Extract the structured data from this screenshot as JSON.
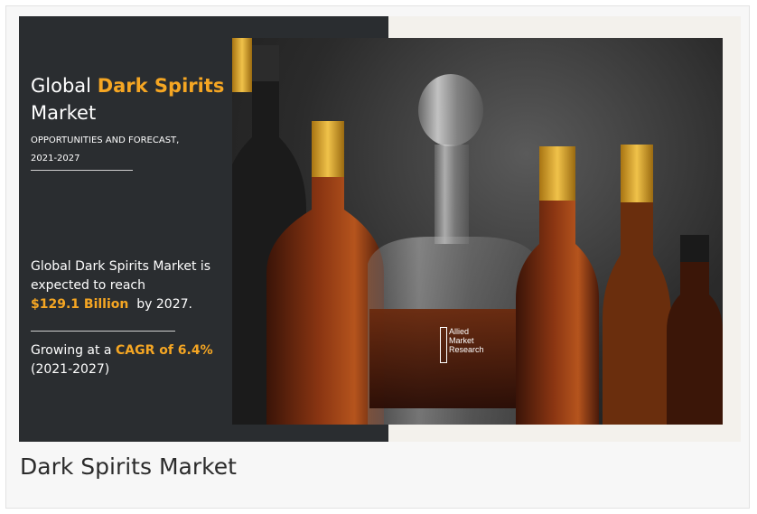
{
  "banner": {
    "title_prefix": "Global",
    "title_highlight": "Dark Spirits",
    "title_suffix": "Market",
    "subtitle_line1": "OPPORTUNITIES AND FORECAST,",
    "subtitle_line2": "2021-2027",
    "statement_line1": "Global Dark Spirits Market is",
    "statement_line2": "expected to reach",
    "statement_value": "$129.1 Billion",
    "statement_suffix": "by 2027.",
    "growth_prefix": "Growing at a",
    "growth_highlight": "CAGR of 6.4%",
    "growth_period": "(2021-2027)",
    "accent_color": "#f5a623",
    "panel_color": "#2a2d30"
  },
  "logo": {
    "line1": "Allied",
    "line2": "Market",
    "line3": "Research"
  },
  "caption": "Dark Spirits Market"
}
